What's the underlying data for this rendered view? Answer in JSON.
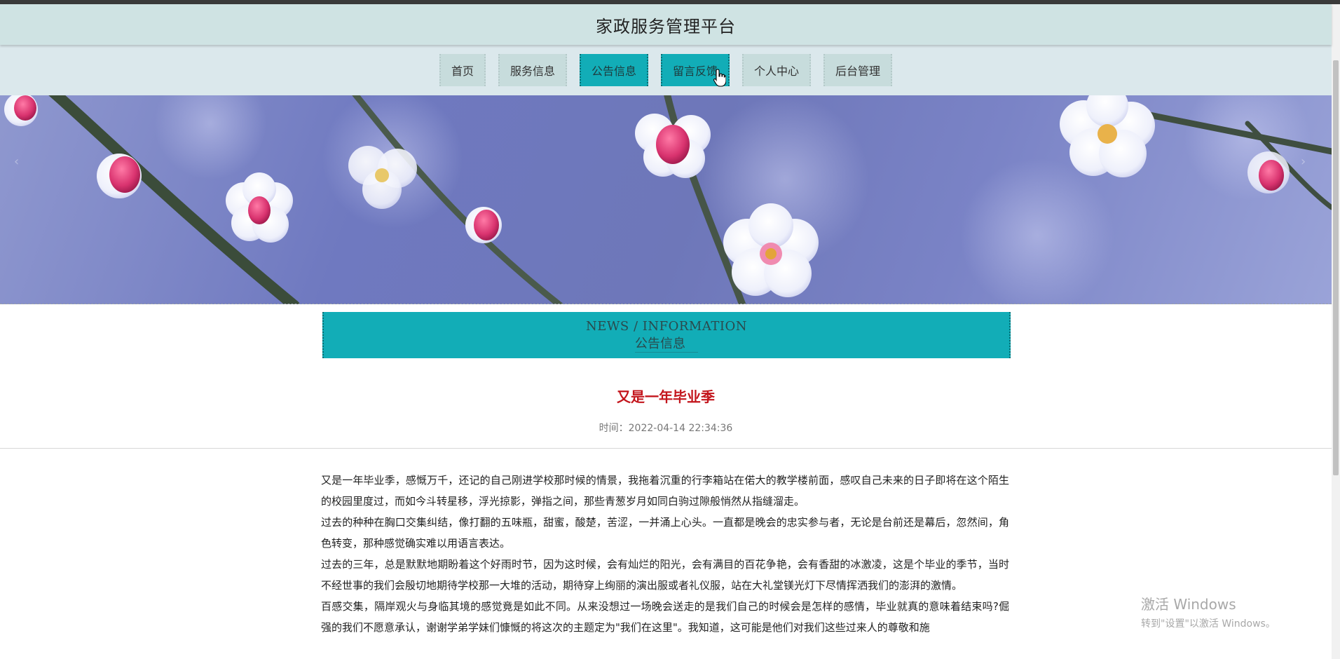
{
  "header": {
    "title": "家政服务管理平台"
  },
  "nav": {
    "items": [
      {
        "label": "首页"
      },
      {
        "label": "服务信息"
      },
      {
        "label": "公告信息"
      },
      {
        "label": "留言反馈"
      },
      {
        "label": "个人中心"
      },
      {
        "label": "后台管理"
      }
    ],
    "active_index": 2
  },
  "banner": {
    "prev_icon": "chevron-left-icon",
    "next_icon": "chevron-right-icon"
  },
  "section": {
    "title_en": "NEWS / INFORMATION",
    "title_cn": "公告信息"
  },
  "article": {
    "title": "又是一年毕业季",
    "time": "时间：2022-04-14 22:34:36",
    "paragraphs": [
      "又是一年毕业季，感慨万千，还记的自己刚进学校那时候的情景，我拖着沉重的行李箱站在偌大的教学楼前面，感叹自己未来的日子即将在这个陌生的校园里度过，而如今斗转星移，浮光掠影，弹指之间，那些青葱岁月如同白驹过隙般悄然从指缝溜走。",
      "过去的种种在胸口交集纠结，像打翻的五味瓶，甜蜜，酸楚，苦涩，一并涌上心头。一直都是晚会的忠实参与者，无论是台前还是幕后，忽然间，角色转变，那种感觉确实难以用语言表达。",
      "过去的三年，总是默默地期盼着这个好雨时节，因为这时候，会有灿烂的阳光，会有满目的百花争艳，会有香甜的冰激凌，这是个毕业的季节，当时不经世事的我们会殷切地期待学校那一大堆的活动，期待穿上绚丽的演出服或者礼仪服，站在大礼堂镁光灯下尽情挥洒我们的澎湃的激情。",
      "百感交集，隔岸观火与身临其境的感觉竟是如此不同。从来没想过一场晚会送走的是我们自己的时候会是怎样的感情，毕业就真的意味着结束吗?倔强的我们不愿意承认，谢谢学弟学妹们慷慨的将这次的主题定为\"我们在这里\"。我知道，这可能是他们对我们这些过来人的尊敬和施"
    ]
  },
  "watermark": {
    "main": "激活 Windows",
    "sub": "转到\"设置\"以激活 Windows。"
  },
  "colors": {
    "accent": "#12adb7",
    "header_bg": "#cfe3e3",
    "nav_bg": "#dbe8ec",
    "nav_item_bg": "#c7dcdc",
    "title_red": "#c3151c"
  }
}
